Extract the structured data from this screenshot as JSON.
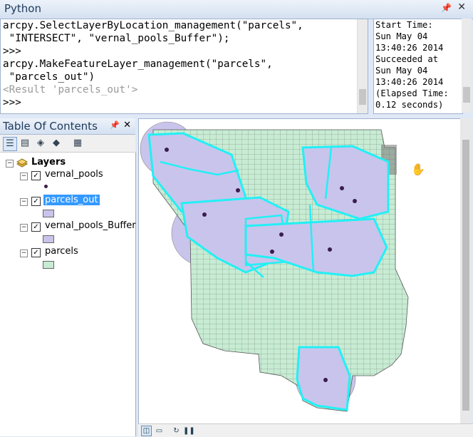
{
  "python": {
    "title": "Python",
    "code_lines": [
      "arcpy.SelectLayerByLocation_management(\"parcels\",",
      " \"INTERSECT\", \"vernal_pools_Buffer\");",
      ">>>",
      "arcpy.MakeFeatureLayer_management(\"parcels\",",
      " \"parcels_out\")",
      "<Result 'parcels_out'>",
      ">>>"
    ],
    "help_lines": [
      "Start Time:",
      "Sun May 04",
      "13:40:26 2014",
      "Succeeded at",
      "Sun May 04",
      "13:40:26 2014",
      "(Elapsed Time:",
      "0.12 seconds)"
    ]
  },
  "toc": {
    "title": "Table Of Contents",
    "root_label": "Layers",
    "layers": [
      {
        "name": "vernal_pools",
        "symbol": "point",
        "color": "#3a1e4a"
      },
      {
        "name": "parcels_out",
        "symbol": "polygon",
        "color": "#c9c4ec",
        "selected": true
      },
      {
        "name": "vernal_pools_Buffer",
        "symbol": "polygon",
        "color": "#c9c4ec"
      },
      {
        "name": "parcels",
        "symbol": "polygon",
        "color": "#c7ecd3"
      }
    ]
  },
  "colors": {
    "parcel_fill": "#c7ecd3",
    "buffer_fill": "#c9c4ec",
    "selection": "#22f0f5",
    "pool_point": "#3a1e4a"
  }
}
